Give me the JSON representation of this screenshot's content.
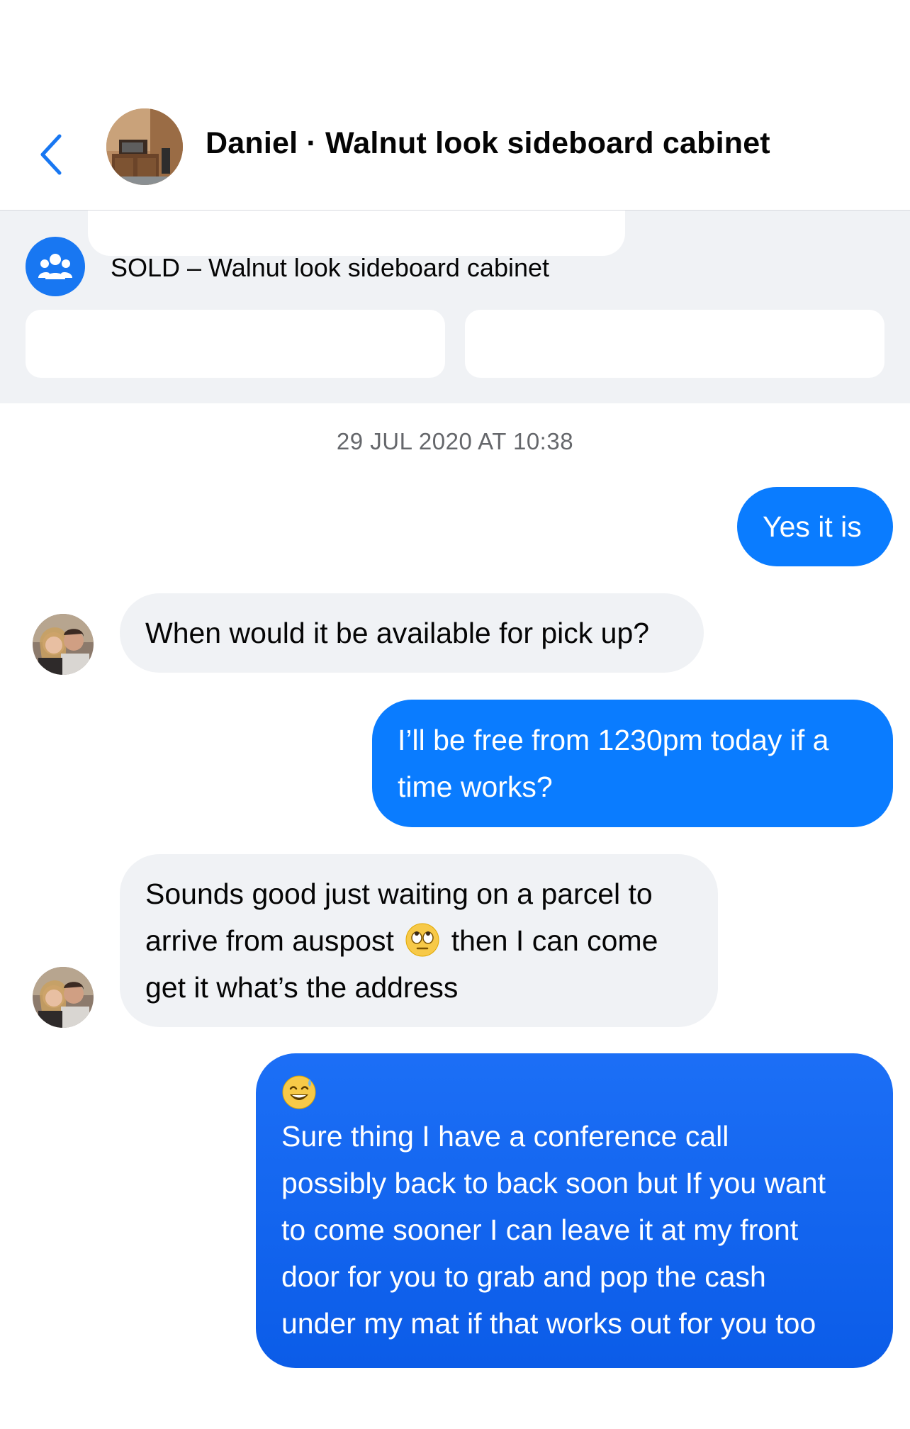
{
  "header": {
    "title": "Daniel · Walnut look sideboard cabinet",
    "back_icon": "chevron-left-icon"
  },
  "banner": {
    "listing_text": "SOLD – Walnut look sideboard cabinet",
    "icon": "group-icon"
  },
  "conversation": {
    "timestamp": "29 JUL 2020 AT 10:38",
    "messages": [
      {
        "sender": "me",
        "lines": [
          "Yes it is"
        ]
      },
      {
        "sender": "Daniel",
        "lines": [
          "When would it be available for pick up?"
        ]
      },
      {
        "sender": "me",
        "lines": [
          "I’ll be free from 1230pm today if a",
          "time works?"
        ]
      },
      {
        "sender": "Daniel",
        "lines": [
          "Sounds good just waiting on a parcel to",
          "arrive from auspost",
          "then I can come",
          "get it what’s the address"
        ],
        "emoji": "eye-roll-emoji"
      },
      {
        "sender": "me",
        "emoji": "grinning-sweat-emoji",
        "lines": [
          "Sure thing I have a conference call",
          "possibly back to back soon but If you want",
          "to come sooner I can leave it at my front",
          "door for you to grab and pop the cash",
          "under my mat if that works out for you too"
        ]
      }
    ]
  },
  "colors": {
    "accent": "#1877f2",
    "outgoing_bubble": "#0a7cff",
    "incoming_bubble": "#f0f2f5",
    "banner_bg": "#f0f2f5",
    "timestamp": "#65676b"
  }
}
